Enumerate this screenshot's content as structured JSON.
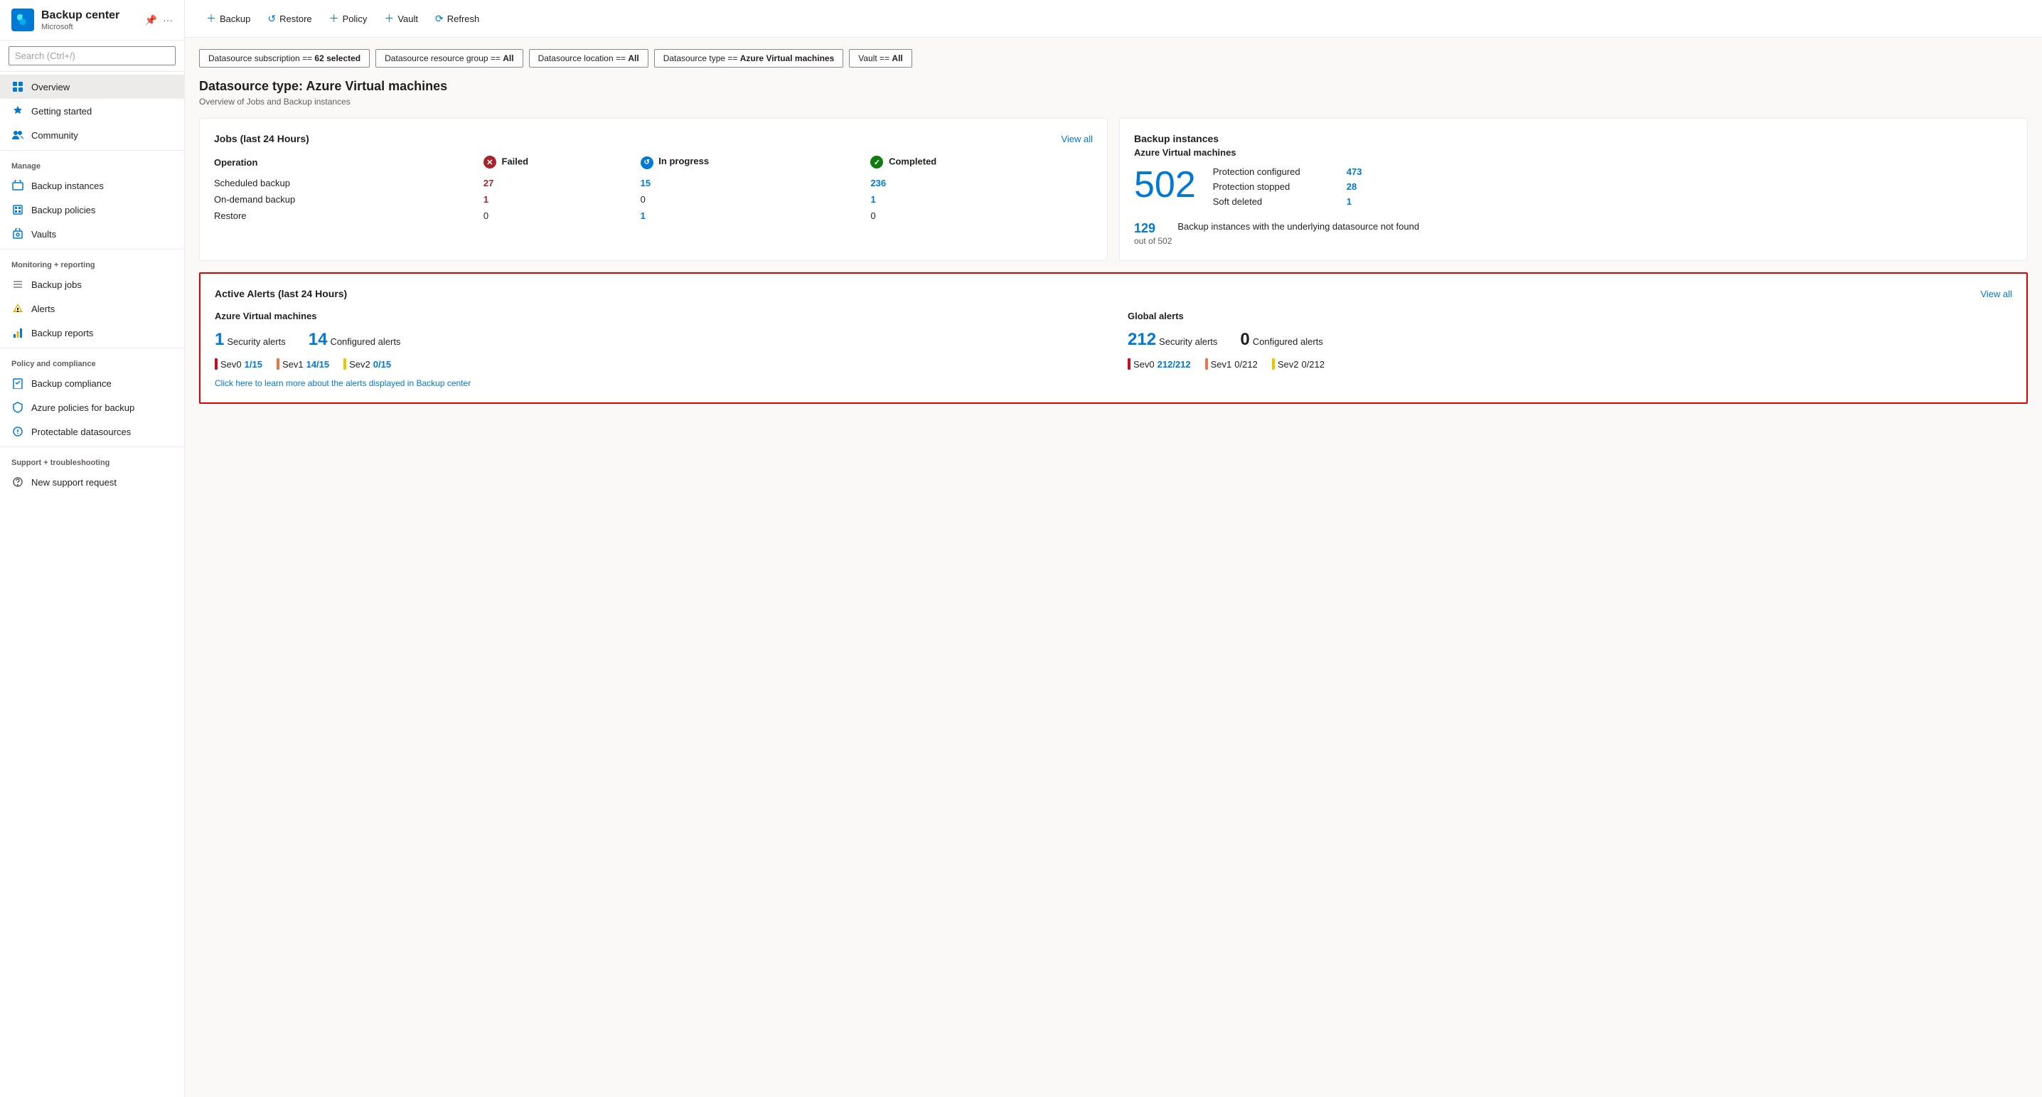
{
  "sidebar": {
    "title": "Backup center",
    "subtitle": "Microsoft",
    "search_placeholder": "Search (Ctrl+/)",
    "nav": {
      "overview": "Overview",
      "getting_started": "Getting started",
      "community": "Community",
      "manage_label": "Manage",
      "backup_instances": "Backup instances",
      "backup_policies": "Backup policies",
      "vaults": "Vaults",
      "monitoring_label": "Monitoring + reporting",
      "backup_jobs": "Backup jobs",
      "alerts": "Alerts",
      "backup_reports": "Backup reports",
      "policy_label": "Policy and compliance",
      "backup_compliance": "Backup compliance",
      "azure_policies": "Azure policies for backup",
      "protectable_datasources": "Protectable datasources",
      "support_label": "Support + troubleshooting",
      "new_support": "New support request"
    }
  },
  "toolbar": {
    "backup_label": "Backup",
    "restore_label": "Restore",
    "policy_label": "Policy",
    "vault_label": "Vault",
    "refresh_label": "Refresh"
  },
  "filters": {
    "subscription": "Datasource subscription == ",
    "subscription_value": "62 selected",
    "resource_group": "Datasource resource group == ",
    "resource_group_value": "All",
    "location": "Datasource location == ",
    "location_value": "All",
    "datasource_type": "Datasource type == ",
    "datasource_type_value": "Azure Virtual machines",
    "vault": "Vault == ",
    "vault_value": "All"
  },
  "page": {
    "title": "Datasource type: Azure Virtual machines",
    "subtitle": "Overview of Jobs and Backup instances"
  },
  "jobs_card": {
    "title": "Jobs (last 24 Hours)",
    "view_all": "View all",
    "col_operation": "Operation",
    "col_failed": "Failed",
    "col_inprogress": "In progress",
    "col_completed": "Completed",
    "rows": [
      {
        "operation": "Scheduled backup",
        "failed": "27",
        "inprogress": "15",
        "completed": "236"
      },
      {
        "operation": "On-demand backup",
        "failed": "1",
        "inprogress": "0",
        "completed": "1"
      },
      {
        "operation": "Restore",
        "failed": "0",
        "inprogress": "1",
        "completed": "0"
      }
    ]
  },
  "backup_instances_card": {
    "title": "Backup instances",
    "azure_subtitle": "Azure Virtual machines",
    "main_count": "502",
    "protection_configured_label": "Protection configured",
    "protection_configured_value": "473",
    "protection_stopped_label": "Protection stopped",
    "protection_stopped_value": "28",
    "soft_deleted_label": "Soft deleted",
    "soft_deleted_value": "1",
    "secondary_count": "129",
    "secondary_out_of": "out of 502",
    "secondary_label": "Backup instances with the underlying datasource not found"
  },
  "alerts_card": {
    "title": "Active Alerts (last 24 Hours)",
    "view_all": "View all",
    "azure_section_title": "Azure Virtual machines",
    "azure_security_count": "1",
    "azure_security_label": "Security alerts",
    "azure_configured_count": "14",
    "azure_configured_label": "Configured alerts",
    "azure_sev": [
      {
        "label": "Sev0",
        "value": "1/15",
        "bar_color": "red"
      },
      {
        "label": "Sev1",
        "value": "14/15",
        "bar_color": "orange"
      },
      {
        "label": "Sev2",
        "value": "0/15",
        "bar_color": "yellow"
      }
    ],
    "global_section_title": "Global alerts",
    "global_security_count": "212",
    "global_security_label": "Security alerts",
    "global_configured_count": "0",
    "global_configured_label": "Configured alerts",
    "global_sev": [
      {
        "label": "Sev0",
        "value": "212/212",
        "bar_color": "red"
      },
      {
        "label": "Sev1",
        "value": "0/212",
        "bar_color": "orange"
      },
      {
        "label": "Sev2",
        "value": "0/212",
        "bar_color": "yellow"
      }
    ],
    "learn_more_link": "Click here to learn more about the alerts displayed in Backup center"
  }
}
